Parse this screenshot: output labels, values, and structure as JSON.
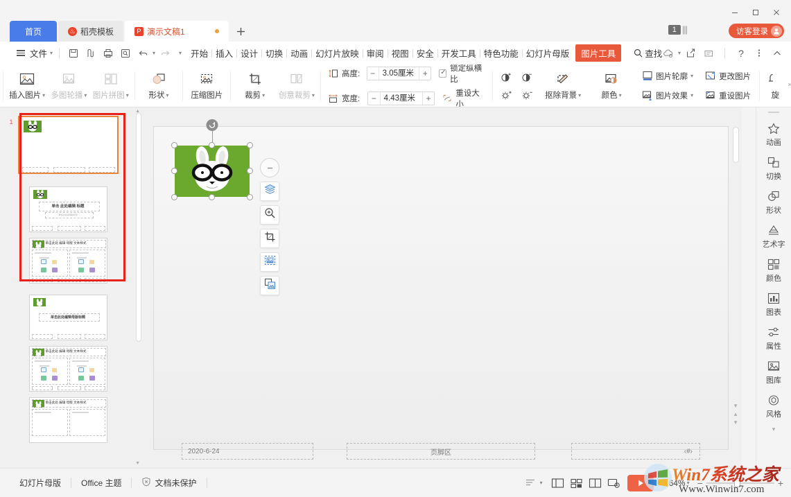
{
  "window": {
    "minimize": "—",
    "maximize": "□",
    "close": "✕"
  },
  "tabbar": {
    "tabs": [
      {
        "label": "首页",
        "icon": "home-icon",
        "type": "home"
      },
      {
        "label": "稻壳模板",
        "icon": "daoke-icon",
        "type": "normal"
      },
      {
        "label": "演示文稿1",
        "icon": "ppt-icon",
        "type": "active"
      }
    ],
    "add_label": "+",
    "page_count": "1",
    "login_label": "访客登录"
  },
  "menubar": {
    "file_label": "文件",
    "quick_access": [
      "save-icon",
      "print-preview-icon",
      "print-icon",
      "print-find-icon",
      "undo-icon",
      "redo-icon",
      "customize-icon"
    ],
    "items": [
      "开始",
      "插入",
      "设计",
      "切换",
      "动画",
      "幻灯片放映",
      "审阅",
      "视图",
      "安全",
      "开发工具",
      "特色功能",
      "幻灯片母版"
    ],
    "highlight": "图片工具",
    "find_label": "查找",
    "right_icons": [
      "cloud-icon",
      "share-icon",
      "comment-icon",
      "help-icon",
      "more-icon",
      "collapse-icon"
    ]
  },
  "ribbon": {
    "buttons": [
      {
        "label": "插入图片",
        "icon": "insert-picture-icon",
        "dropdown": true,
        "disabled": false
      },
      {
        "label": "多图轮播",
        "icon": "carousel-icon",
        "dropdown": true,
        "disabled": true
      },
      {
        "label": "图片拼图",
        "icon": "collage-icon",
        "dropdown": true,
        "disabled": true
      },
      {
        "label": "形状",
        "icon": "shape-icon",
        "dropdown": true,
        "disabled": false
      },
      {
        "label": "压缩图片",
        "icon": "compress-picture-icon",
        "dropdown": false,
        "disabled": false
      },
      {
        "label": "裁剪",
        "icon": "crop-icon",
        "dropdown": true,
        "disabled": false
      },
      {
        "label": "创意裁剪",
        "icon": "creative-crop-icon",
        "dropdown": true,
        "disabled": true
      }
    ],
    "size": {
      "height_label": "高度:",
      "height_value": "3.05厘米",
      "width_label": "宽度:",
      "width_value": "4.43厘米",
      "minus": "−",
      "plus": "+",
      "lock_label": "锁定纵横比",
      "lock_checked": true,
      "reset_label": "重设大小"
    },
    "adjust": {
      "contrast_up": "contrast-increase-icon",
      "contrast_down": "contrast-decrease-icon",
      "brightness_up": "brightness-increase-icon",
      "brightness_down": "brightness-decrease-icon"
    },
    "tools": [
      {
        "label": "抠除背景",
        "icon": "remove-background-icon",
        "dropdown": true
      },
      {
        "label": "颜色",
        "icon": "color-icon",
        "dropdown": true
      },
      {
        "label": "图片轮廓",
        "icon": "picture-outline-icon",
        "dropdown": true
      },
      {
        "label": "图片效果",
        "icon": "picture-effects-icon",
        "dropdown": true
      },
      {
        "label": "更改图片",
        "icon": "change-picture-icon",
        "dropdown": false
      },
      {
        "label": "重设图片",
        "icon": "reset-picture-icon",
        "dropdown": false
      },
      {
        "label": "旋",
        "icon": "rotate-icon",
        "dropdown": true
      }
    ]
  },
  "thumbnails": {
    "slides": [
      {
        "number": "1",
        "selected": true,
        "title": "",
        "subtitle": "",
        "layout": "title-blank"
      },
      {
        "number": "2",
        "selected": false,
        "title": "单击 此处编辑 标题",
        "subtitle": "单击此处编辑副标题",
        "layout": "title"
      },
      {
        "number": "3",
        "selected": false,
        "title": "单击此处 编辑 母版 文本样式",
        "subtitle": "",
        "layout": "two-content"
      },
      {
        "number": "4",
        "selected": false,
        "title": "单击此处编辑母版标题",
        "subtitle": "",
        "layout": "title"
      },
      {
        "number": "5",
        "selected": false,
        "title": "单击此处 编辑 母版 文本样式",
        "subtitle": "",
        "layout": "two-content"
      },
      {
        "number": "6",
        "selected": false,
        "title": "单击此处 编辑 母版 文本样式",
        "subtitle": "",
        "layout": "two-content"
      }
    ]
  },
  "slide": {
    "placeholders": {
      "date": "2020-6-24",
      "footer": "页脚区",
      "slide_number": "‹#›"
    },
    "picture": {
      "name": "rabbit-image",
      "background_color": "#6aa82e",
      "selected": true
    },
    "float_toolbar": [
      {
        "icon": "collapse-toolbar-icon",
        "name": "collapse-floating-toolbar"
      },
      {
        "icon": "layers-icon",
        "name": "arrange-layers-button"
      },
      {
        "icon": "zoom-in-icon",
        "name": "zoom-picture-button"
      },
      {
        "icon": "crop-icon",
        "name": "crop-button"
      },
      {
        "icon": "select-picture-icon",
        "name": "smart-select-button"
      },
      {
        "icon": "duplicate-icon",
        "name": "duplicate-button"
      }
    ]
  },
  "sidebar": {
    "items": [
      {
        "label": "动画",
        "icon": "animation-icon"
      },
      {
        "label": "切换",
        "icon": "transition-icon"
      },
      {
        "label": "形状",
        "icon": "shape-icon"
      },
      {
        "label": "艺术字",
        "icon": "wordart-icon"
      },
      {
        "label": "颜色",
        "icon": "color-palette-icon"
      },
      {
        "label": "图表",
        "icon": "chart-icon"
      },
      {
        "label": "属性",
        "icon": "properties-icon"
      },
      {
        "label": "图库",
        "icon": "gallery-icon"
      },
      {
        "label": "风格",
        "icon": "style-icon"
      }
    ]
  },
  "statusbar": {
    "left_items": [
      {
        "label": "幻灯片母版",
        "icon": ""
      },
      {
        "label": "Office 主题",
        "icon": ""
      },
      {
        "label": "文档未保护",
        "icon": "shield-icon"
      }
    ],
    "view_icons": [
      {
        "name": "outline-view-icon",
        "dropdown": true
      },
      {
        "name": "normal-view-icon",
        "dropdown": false
      },
      {
        "name": "slide-sorter-icon",
        "dropdown": false
      },
      {
        "name": "reading-view-icon",
        "dropdown": false
      },
      {
        "name": "presenter-view-icon",
        "dropdown": false
      }
    ],
    "play_label": "▶",
    "zoom_value": "64%",
    "zoom_out": "−",
    "zoom_in": "+"
  },
  "watermark": {
    "text_main": "Win7系统之家",
    "text_sub": "Www.Winwin7.com"
  }
}
